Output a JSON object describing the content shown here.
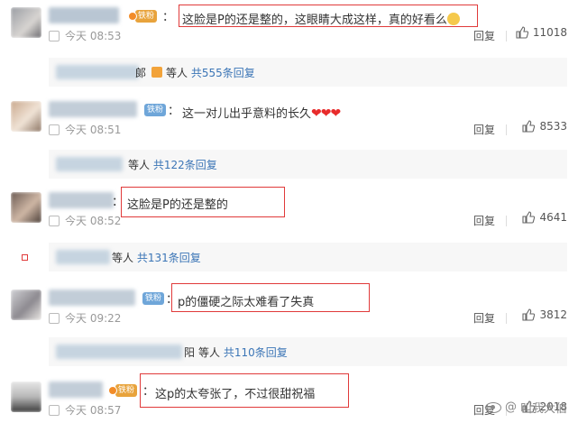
{
  "common": {
    "colon": "：",
    "reply_label": "回复",
    "deng_ren": "等人",
    "watermark_text": "叫我大伯"
  },
  "colors": {
    "accent_link": "#3b75b6",
    "highlight_box": "#e03a3a",
    "hearts": "#e82b2b",
    "badge_gold": "#e8a33c",
    "badge_blue": "#6fa6d9"
  },
  "comments": [
    {
      "badge": "铁粉",
      "badge_style": "gold",
      "text": "这脸是P的还是整的，这眼睛大成这样，真的好看么",
      "emoji": "thinking-face-icon",
      "time": "今天 08:53",
      "likes": "11018",
      "replies": {
        "visible_end": "郞",
        "summary": "共555条回复"
      }
    },
    {
      "badge": "铁粉",
      "badge_style": "blue",
      "text": "这一对儿出乎意料的长久",
      "hearts": "❤❤❤",
      "time": "今天 08:51",
      "likes": "8533",
      "replies": {
        "visible_end": "",
        "summary": "共122条回复"
      }
    },
    {
      "badge": "",
      "badge_style": "none",
      "text": "这脸是P的还是整的",
      "time": "今天 08:52",
      "likes": "4641",
      "replies": {
        "visible_end": "",
        "summary": "共131条回复"
      }
    },
    {
      "badge": "铁粉",
      "badge_style": "blue",
      "text": "p的僵硬之际太难看了失真",
      "time": "今天 09:22",
      "likes": "3812",
      "replies": {
        "visible_end": "阳",
        "summary": "共110条回复"
      }
    },
    {
      "badge": "铁粉",
      "badge_style": "gold",
      "text": "这p的太夸张了，不过很甜祝福",
      "time": "今天 08:57",
      "likes": "2018",
      "replies": null
    }
  ]
}
